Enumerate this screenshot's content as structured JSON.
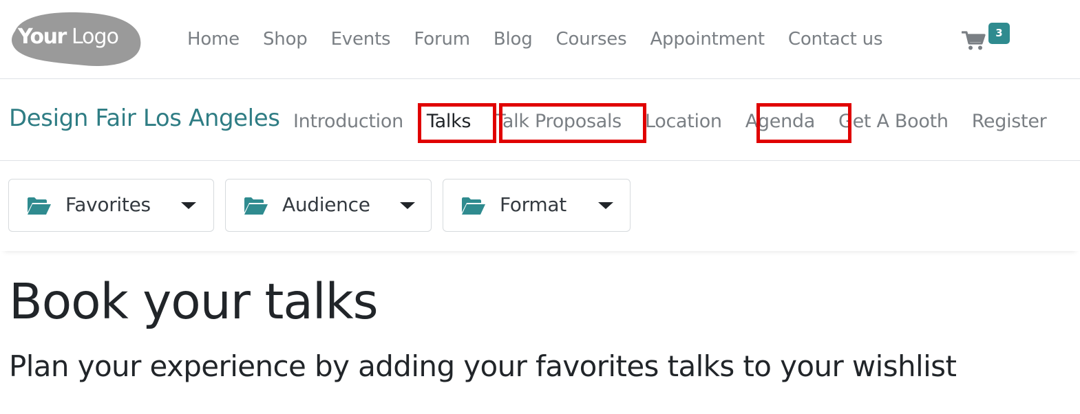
{
  "header": {
    "logo_text": "YourLogo",
    "nav": [
      "Home",
      "Shop",
      "Events",
      "Forum",
      "Blog",
      "Courses",
      "Appointment",
      "Contact us"
    ],
    "cart": {
      "icon": "shopping-cart-icon",
      "count": "3"
    }
  },
  "event": {
    "title": "Design Fair Los Angeles",
    "nav": [
      {
        "label": "Introduction",
        "active": false,
        "highlighted": false
      },
      {
        "label": "Talks",
        "active": true,
        "highlighted": true
      },
      {
        "label": "Talk Proposals",
        "active": false,
        "highlighted": true
      },
      {
        "label": "Location",
        "active": false,
        "highlighted": false
      },
      {
        "label": "Agenda",
        "active": false,
        "highlighted": true
      },
      {
        "label": "Get A Booth",
        "active": false,
        "highlighted": false
      },
      {
        "label": "Register",
        "active": false,
        "highlighted": false
      }
    ]
  },
  "filters": [
    {
      "icon": "folder-open-icon",
      "label": "Favorites"
    },
    {
      "icon": "folder-open-icon",
      "label": "Audience"
    },
    {
      "icon": "folder-open-icon",
      "label": "Format"
    }
  ],
  "content": {
    "title": "Book your talks",
    "subtitle": "Plan your experience by adding your favorites talks to your wishlist"
  },
  "colors": {
    "accent": "#2f8b8f",
    "event_title": "#2f7d84",
    "highlight": "#e00000",
    "nav_text": "#7a7f84",
    "active_text": "#212529"
  }
}
